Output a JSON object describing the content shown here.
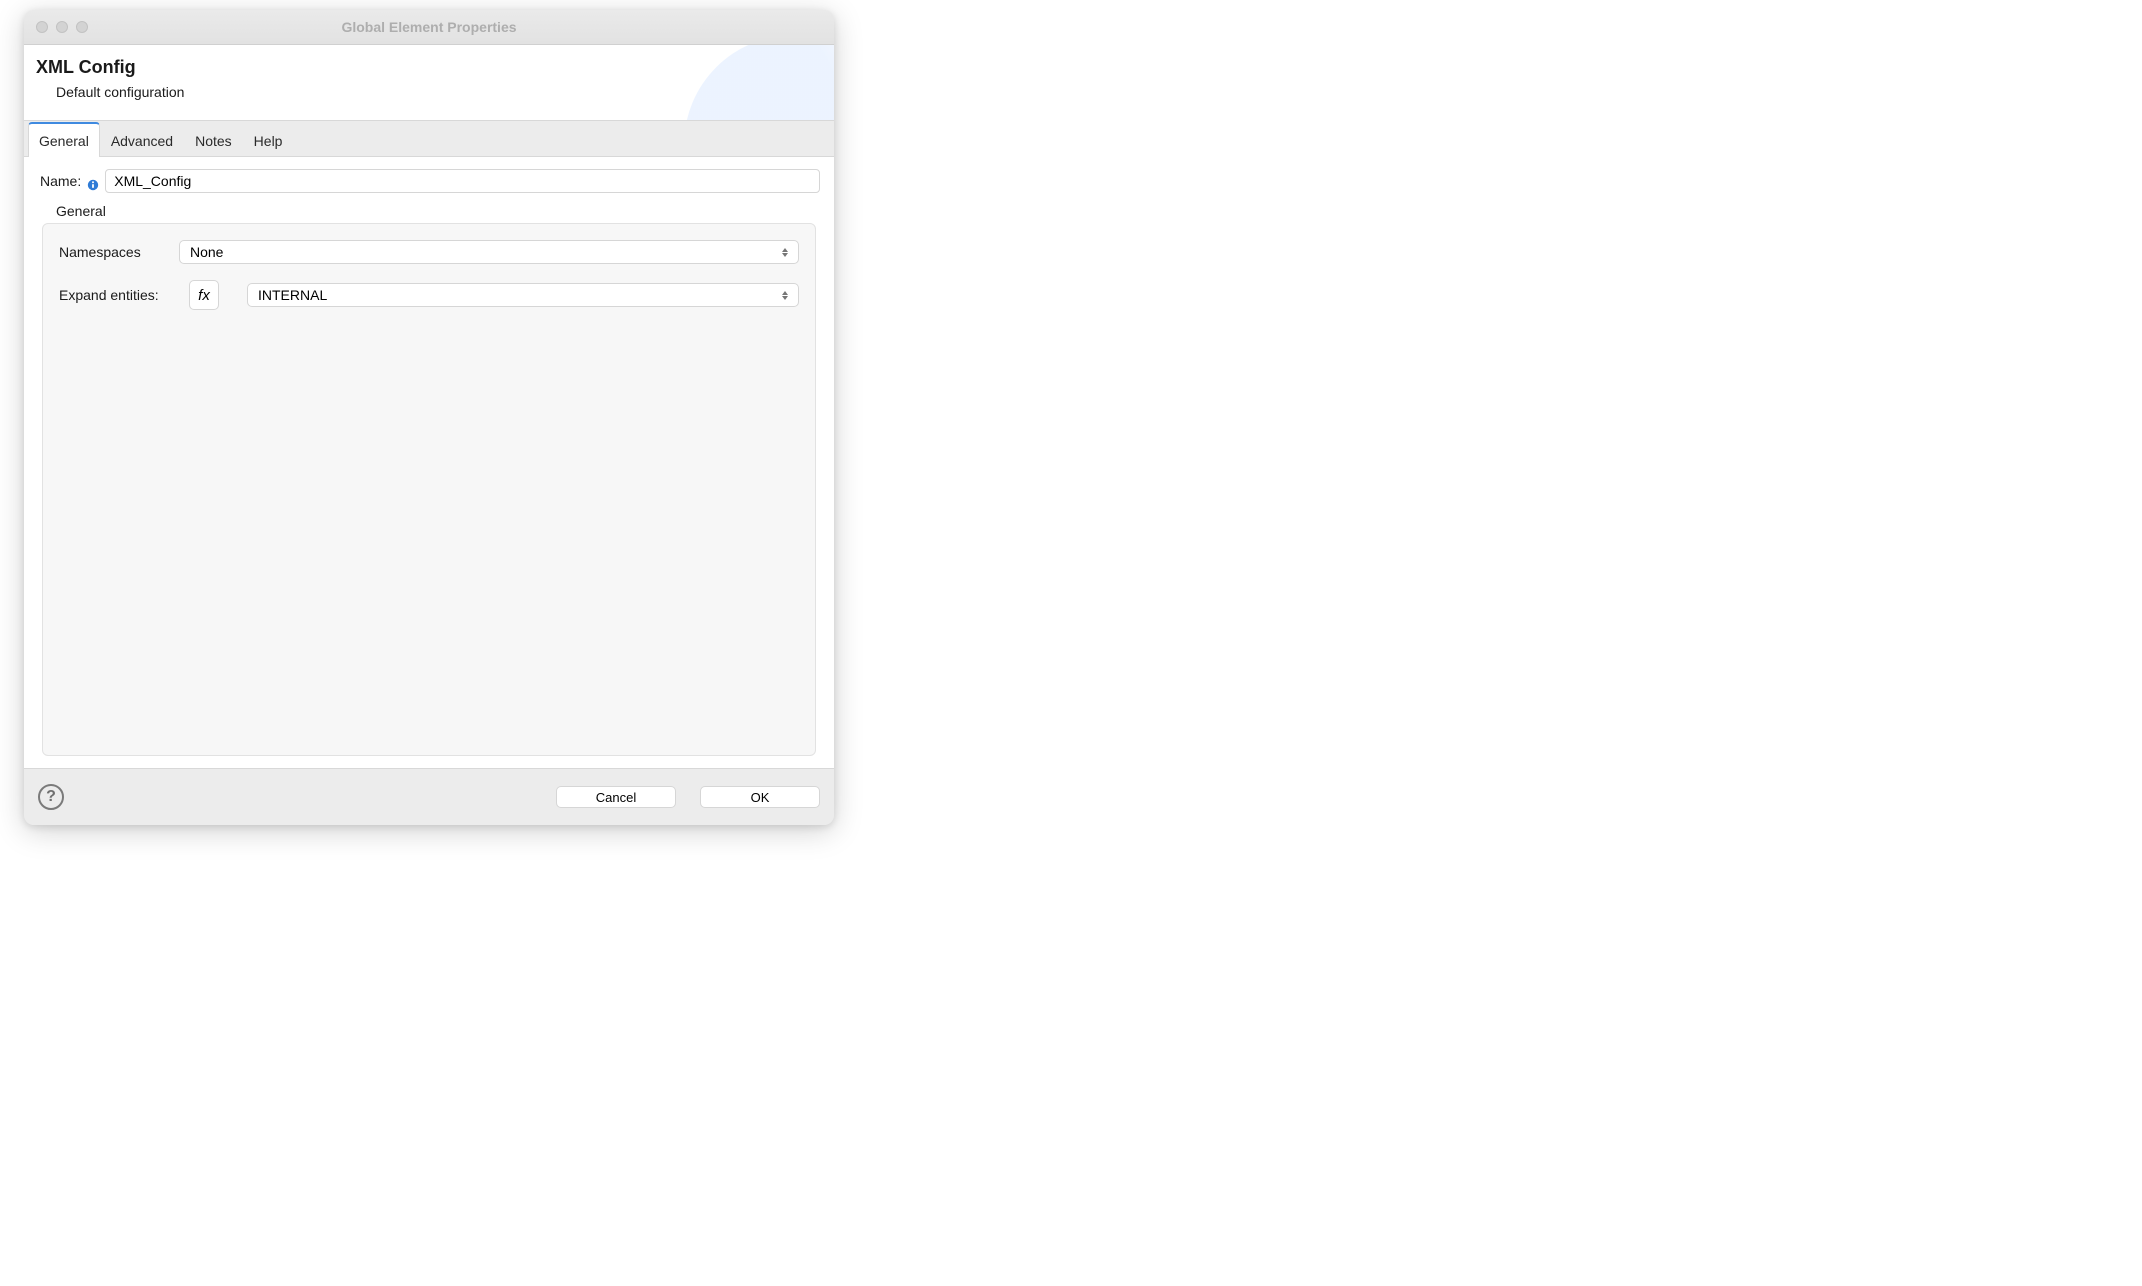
{
  "window": {
    "title": "Global Element Properties"
  },
  "header": {
    "title": "XML Config",
    "subtitle": "Default configuration"
  },
  "tabs": [
    {
      "label": "General",
      "active": true
    },
    {
      "label": "Advanced",
      "active": false
    },
    {
      "label": "Notes",
      "active": false
    },
    {
      "label": "Help",
      "active": false
    }
  ],
  "form": {
    "name_label": "Name:",
    "name_value": "XML_Config",
    "section_label": "General",
    "namespaces_label": "Namespaces",
    "namespaces_value": "None",
    "expand_entities_label": "Expand entities:",
    "expand_entities_value": "INTERNAL",
    "fx_label": "fx"
  },
  "footer": {
    "help_glyph": "?",
    "cancel_label": "Cancel",
    "ok_label": "OK"
  }
}
